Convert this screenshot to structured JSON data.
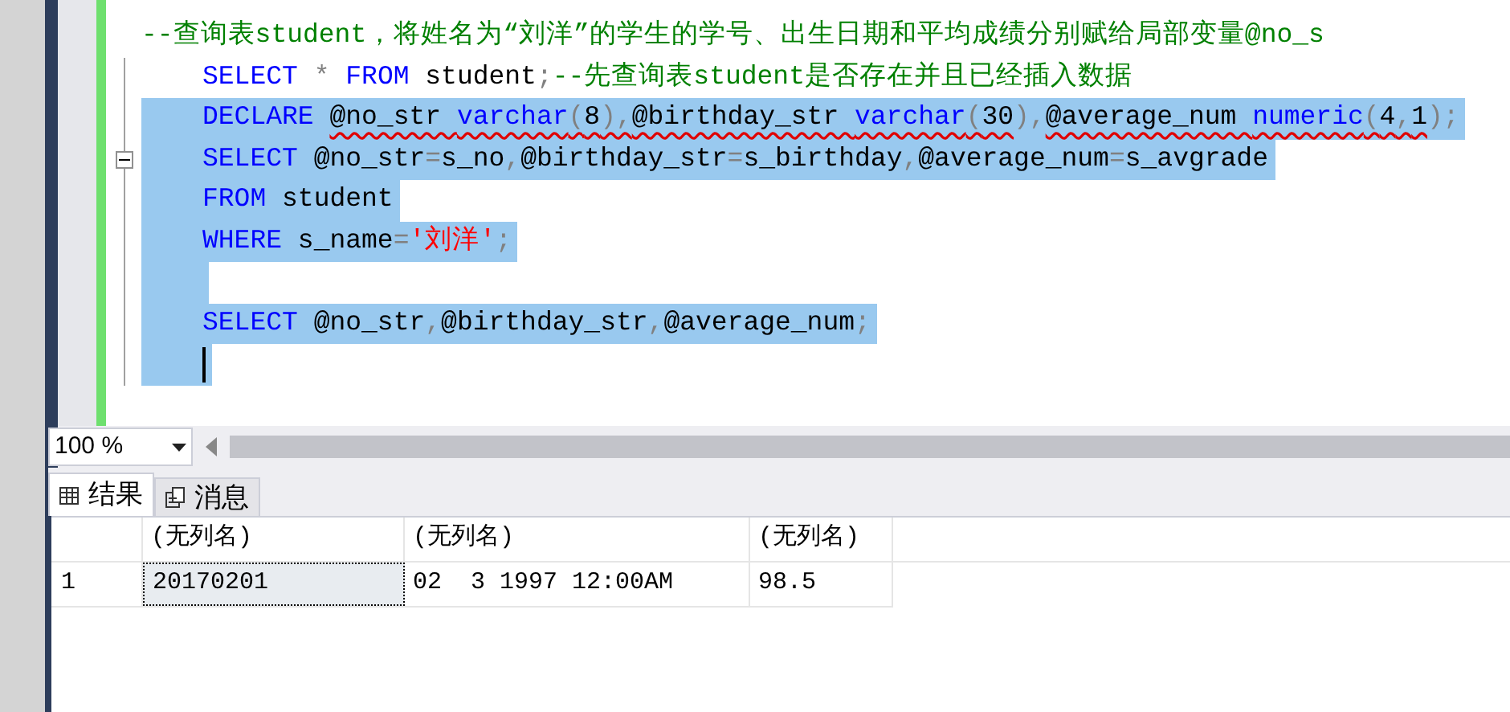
{
  "editor": {
    "lines": [
      {
        "selected": false,
        "tokens": [
          {
            "kind": "comment",
            "text": "--查询表student，将姓名为“刘洋”的学生的学号、出生日期和平均成绩分别赋给局部变量@no_s"
          }
        ]
      },
      {
        "indented": true,
        "selected": false,
        "tokens": [
          {
            "kind": "keyword",
            "text": "SELECT"
          },
          {
            "kind": "punct",
            "text": " * "
          },
          {
            "kind": "keyword",
            "text": "FROM"
          },
          {
            "kind": "plain",
            "text": " student"
          },
          {
            "kind": "punct",
            "text": ";"
          },
          {
            "kind": "comment",
            "text": "--先查询表student是否存在并且已经插入数据"
          }
        ]
      },
      {
        "indented": true,
        "selected": true,
        "tokens": [
          {
            "kind": "keyword",
            "text": "DECLARE "
          },
          {
            "kind": "plain",
            "text": "@no_str ",
            "error": true
          },
          {
            "kind": "keyword",
            "text": "varchar",
            "error": true
          },
          {
            "kind": "punct",
            "text": "(",
            "error": true
          },
          {
            "kind": "plain",
            "text": "8",
            "error": true
          },
          {
            "kind": "punct",
            "text": "),",
            "error": true
          },
          {
            "kind": "plain",
            "text": "@birthday_str ",
            "error": true
          },
          {
            "kind": "keyword",
            "text": "varchar",
            "error": true
          },
          {
            "kind": "punct",
            "text": "(",
            "error": true
          },
          {
            "kind": "plain",
            "text": "30",
            "error": true
          },
          {
            "kind": "punct",
            "text": "),"
          },
          {
            "kind": "plain",
            "text": "@average_num ",
            "error": true
          },
          {
            "kind": "keyword",
            "text": "numeric",
            "error": true
          },
          {
            "kind": "punct",
            "text": "(",
            "error": true
          },
          {
            "kind": "plain",
            "text": "4",
            "error": true
          },
          {
            "kind": "punct",
            "text": ",",
            "error": true
          },
          {
            "kind": "plain",
            "text": "1",
            "error": true
          },
          {
            "kind": "punct",
            "text": ");"
          }
        ]
      },
      {
        "indented": true,
        "selected": true,
        "fold": true,
        "tokens": [
          {
            "kind": "keyword",
            "text": "SELECT"
          },
          {
            "kind": "plain",
            "text": " @no_str"
          },
          {
            "kind": "punct",
            "text": "="
          },
          {
            "kind": "plain",
            "text": "s_no"
          },
          {
            "kind": "punct",
            "text": ","
          },
          {
            "kind": "plain",
            "text": "@birthday_str"
          },
          {
            "kind": "punct",
            "text": "="
          },
          {
            "kind": "plain",
            "text": "s_birthday"
          },
          {
            "kind": "punct",
            "text": ","
          },
          {
            "kind": "plain",
            "text": "@average_num"
          },
          {
            "kind": "punct",
            "text": "="
          },
          {
            "kind": "plain",
            "text": "s_avgrade"
          }
        ]
      },
      {
        "indented": true,
        "selected": true,
        "tokens": [
          {
            "kind": "keyword",
            "text": "FROM"
          },
          {
            "kind": "plain",
            "text": " student"
          }
        ]
      },
      {
        "indented": true,
        "selected": true,
        "tokens": [
          {
            "kind": "keyword",
            "text": "WHERE"
          },
          {
            "kind": "plain",
            "text": " s_name"
          },
          {
            "kind": "punct",
            "text": "="
          },
          {
            "kind": "string",
            "text": "'刘洋'"
          },
          {
            "kind": "punct",
            "text": ";"
          }
        ]
      },
      {
        "indented": true,
        "selected": true
      },
      {
        "indented": true,
        "selected": true,
        "tokens": [
          {
            "kind": "keyword",
            "text": "SELECT"
          },
          {
            "kind": "plain",
            "text": " @no_str"
          },
          {
            "kind": "punct",
            "text": ","
          },
          {
            "kind": "plain",
            "text": "@birthday_str"
          },
          {
            "kind": "punct",
            "text": ","
          },
          {
            "kind": "plain",
            "text": "@average_num"
          },
          {
            "kind": "punct",
            "text": ";"
          }
        ]
      },
      {
        "indented": true,
        "selected": true,
        "cursor": true
      }
    ]
  },
  "zoom": {
    "value": "100 %"
  },
  "results_tabs": [
    {
      "label": "结果",
      "selected": true,
      "kind": "grid"
    },
    {
      "label": "消息",
      "selected": false,
      "kind": "messages"
    }
  ],
  "grid": {
    "columns": [
      "(无列名)",
      "(无列名)",
      "(无列名)"
    ],
    "rows": [
      {
        "number": "1",
        "cells": [
          {
            "text": "20170201",
            "selected": true
          },
          {
            "text": "02  3 1997 12:00AM",
            "selected": false
          },
          {
            "text": "98.5",
            "selected": false
          }
        ]
      }
    ]
  }
}
